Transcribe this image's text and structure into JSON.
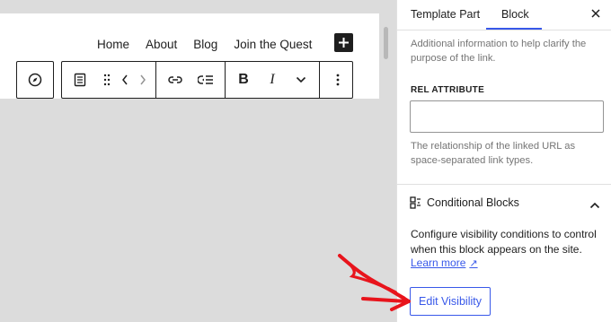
{
  "canvas": {
    "nav_items": [
      "Home",
      "About",
      "Blog",
      "Join the Quest"
    ],
    "add_icon": "plus-icon"
  },
  "toolbar": {
    "icons": [
      "compass-icon",
      "document-icon",
      "drag-handle-icon",
      "chevron-left-icon",
      "chevron-right-icon",
      "link-icon",
      "submenu-icon",
      "bold-icon",
      "italic-icon",
      "chevron-down-icon",
      "more-vertical-icon"
    ],
    "bold_label": "B",
    "italic_label": "I"
  },
  "sidebar": {
    "tabs": [
      "Template Part",
      "Block"
    ],
    "active_tab": "Block",
    "help_link_desc": "Additional information to help clarify the purpose of the link.",
    "rel_label": "REL ATTRIBUTE",
    "rel_value": "",
    "rel_help": "The relationship of the linked URL as space-separated link types.",
    "panel": {
      "title": "Conditional Blocks",
      "description": "Configure visibility conditions to control when this block appears on the site.",
      "learn_more": "Learn more",
      "learn_more_arrow": "↗",
      "edit_button": "Edit Visibility"
    }
  },
  "colors": {
    "accent": "#3858e9",
    "annotation": "#e8141c",
    "canvas_bg": "#dcdcdc"
  }
}
